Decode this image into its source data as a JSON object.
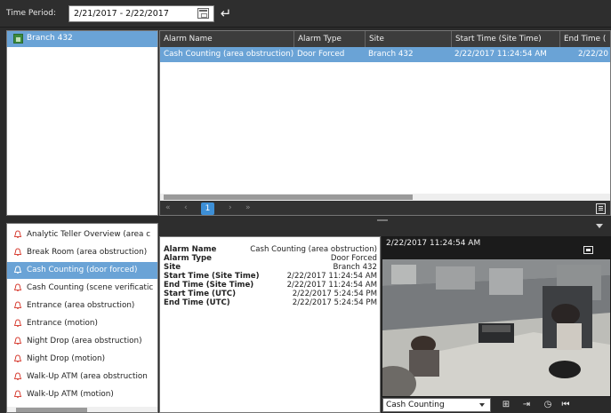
{
  "toolbar": {
    "time_period_label": "Time Period:",
    "time_period_value": "2/21/2017 - 2/22/2017"
  },
  "tree": {
    "items": [
      {
        "label": "Branch 432"
      }
    ]
  },
  "grid": {
    "columns": [
      "Alarm Name",
      "Alarm Type",
      "Site",
      "Start Time (Site Time)",
      "End Time ("
    ],
    "rows": [
      [
        "Cash Counting (area obstruction)",
        "Door Forced",
        "Branch 432",
        "2/22/2017  11:24:54 AM",
        "2/22/20"
      ]
    ],
    "pager": {
      "first": "«",
      "prev": "‹",
      "current": "1",
      "next": "›",
      "last": "»"
    }
  },
  "alarm_list": {
    "items": [
      {
        "label": "Analytic Teller Overview (area c",
        "selected": false
      },
      {
        "label": "Break Room (area obstruction)",
        "selected": false
      },
      {
        "label": "Cash Counting  (door forced)",
        "selected": true
      },
      {
        "label": "Cash Counting (scene verificatic",
        "selected": false
      },
      {
        "label": "Entrance (area obstruction)",
        "selected": false
      },
      {
        "label": "Entrance (motion)",
        "selected": false
      },
      {
        "label": "Night Drop (area obstruction)",
        "selected": false
      },
      {
        "label": "Night Drop (motion)",
        "selected": false
      },
      {
        "label": "Walk-Up ATM (area obstruction",
        "selected": false
      },
      {
        "label": "Walk-Up ATM (motion)",
        "selected": false
      }
    ]
  },
  "details": {
    "fields": [
      {
        "label": "Alarm Name",
        "value": "Cash Counting (area obstruction)"
      },
      {
        "label": "Alarm Type",
        "value": "Door Forced"
      },
      {
        "label": "Site",
        "value": "Branch 432"
      },
      {
        "label": "Start Time (Site Time)",
        "value": "2/22/2017 11:24:54 AM"
      },
      {
        "label": "End Time (Site Time)",
        "value": "2/22/2017 11:24:54 AM"
      },
      {
        "label": "Start Time (UTC)",
        "value": "2/22/2017 5:24:54 PM"
      },
      {
        "label": "End Time (UTC)",
        "value": "2/22/2017 5:24:54 PM"
      }
    ]
  },
  "video": {
    "timestamp": "2/22/2017  11:24:54 AM",
    "camera": "Cash Counting"
  },
  "colors": {
    "selection": "#6aa3d6",
    "dark_chrome": "#2e2e2e",
    "pager_active": "#3d8fd6",
    "alarm_bell": "#d9473c"
  }
}
